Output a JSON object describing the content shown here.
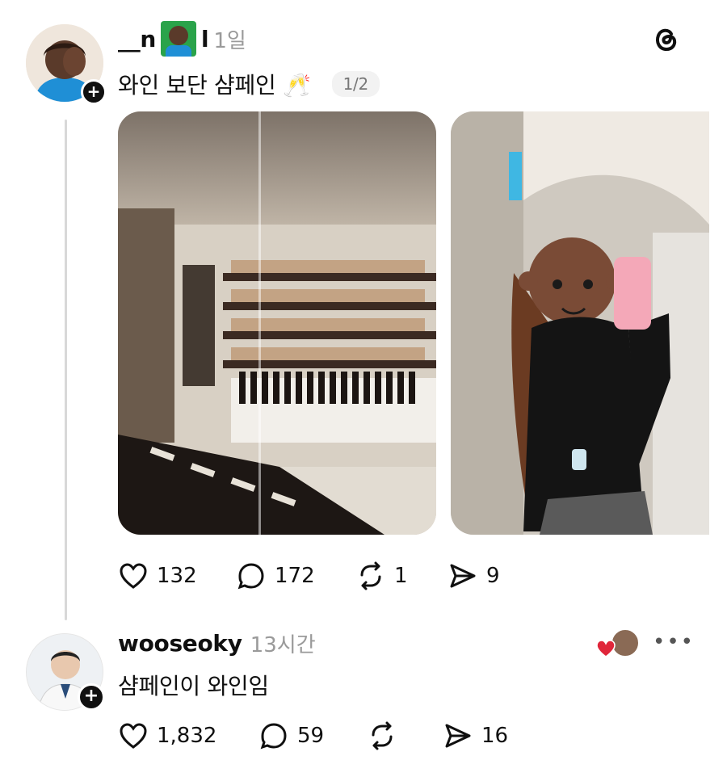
{
  "app": {
    "logo_icon": "threads-logo-icon"
  },
  "post": {
    "username": "__n",
    "username_tail": "l",
    "time": "1일",
    "text": "와인 보단 샴페인 🥂",
    "image_counter": "1/2",
    "stats": {
      "likes": "132",
      "comments": "172",
      "reposts": "1",
      "shares": "9"
    }
  },
  "reply": {
    "username": "wooseoky",
    "time": "13시간",
    "text": "샴페인이 와인임",
    "stats": {
      "likes": "1,832",
      "comments": "59",
      "reposts": "",
      "shares": "16"
    }
  },
  "colors": {
    "text": "#101010",
    "muted": "#9a9a9a",
    "heart": "#e0263a",
    "line": "#d8d8d8"
  }
}
